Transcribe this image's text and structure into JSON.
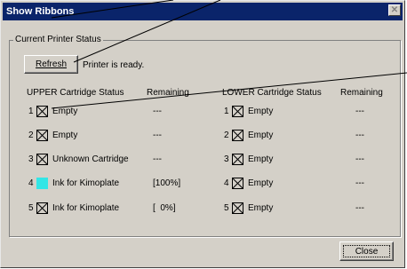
{
  "window": {
    "title": "Show Ribbons",
    "close_glyph": "✕"
  },
  "group_label": "Current Printer Status",
  "refresh_label": "Refresh",
  "status_text": "Printer is ready.",
  "headers": {
    "upper": "UPPER Cartridge Status",
    "upper_remaining": "Remaining",
    "lower": "LOWER Cartridge Status",
    "lower_remaining": "Remaining"
  },
  "upper": [
    {
      "num": "1",
      "name": "Empty",
      "remaining": "---",
      "cyan": false
    },
    {
      "num": "2",
      "name": "Empty",
      "remaining": "---",
      "cyan": false
    },
    {
      "num": "3",
      "name": "Unknown Cartridge",
      "remaining": "---",
      "cyan": false
    },
    {
      "num": "4",
      "name": "Ink for Kimoplate",
      "remaining": "[100%]",
      "cyan": true
    },
    {
      "num": "5",
      "name": "Ink for Kimoplate",
      "remaining": "[  0%]",
      "cyan": false
    }
  ],
  "lower": [
    {
      "num": "1",
      "name": "Empty",
      "remaining": "---"
    },
    {
      "num": "2",
      "name": "Empty",
      "remaining": "---"
    },
    {
      "num": "3",
      "name": "Empty",
      "remaining": "---"
    },
    {
      "num": "4",
      "name": "Empty",
      "remaining": "---"
    },
    {
      "num": "5",
      "name": "Empty",
      "remaining": "---"
    }
  ],
  "close_label": "Close"
}
